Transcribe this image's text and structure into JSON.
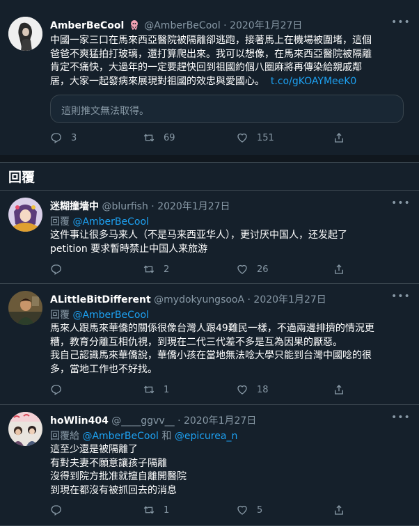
{
  "main_tweet": {
    "name": "AmberBeCool",
    "handle": "@AmberBeCool · 2020年1月27日",
    "lines": [
      "中國一家三口在馬來西亞醫院被隔離卻逃跑，接著馬上在機場被圍堵，這個",
      "爸爸不爽猛拍打玻璃，還打算爬出來。我可以想像，在馬來西亞醫院被隔離",
      "肯定不痛快，大過年的一定要趕快回到祖國約個八圈麻將再傳染給親戚鄰",
      "居，大家一起發病來展現對祖國的效忠與愛國心。"
    ],
    "link": "t.co/gKOAYMeeK0",
    "quote_text": "這則推文無法取得。",
    "replies": "3",
    "retweets": "69",
    "likes": "151"
  },
  "section_title": "回覆",
  "replies": [
    {
      "name": "迷糊撞墻中",
      "handle": "@blurfish · 2020年1月27日",
      "reply_prefix": "回覆",
      "reply_to": "@AmberBeCool",
      "lines": [
        "这件事让很多马来人（不是马来西亚华人），更讨厌中国人，还发起了",
        "petition 要求暫時禁止中国人来旅游"
      ],
      "retweets": "2",
      "likes": "26"
    },
    {
      "name": "ALittleBitDifferent",
      "handle": "@mydokyungsooA · 2020年1月27日",
      "reply_prefix": "回覆",
      "reply_to": "@AmberBeCool",
      "lines": [
        "馬來人跟馬來華僑的關係很像台灣人跟49難民一樣，不過兩邊排擠的情況更",
        "糟，教育分離互相仇視，到現在二代三代差不多是互為因果的厭惡。",
        "我自己認識馬來華僑說，華僑小孩在當地無法唸大學只能到台灣中國唸的很",
        "多，當地工作也不好找。"
      ],
      "retweets": "1",
      "likes": "18"
    },
    {
      "name": "hoWlin404",
      "handle": "@____ggvv__ · 2020年1月27日",
      "reply_prefix": "回覆給",
      "reply_to": "@AmberBeCool",
      "reply_and": "和",
      "reply_to2": "@epicurea_n",
      "lines": [
        "這至少還是被隔離了",
        "有對夫妻不願意讓孩子隔離",
        "沒得到院方批准就擅自離開醫院",
        "到現在都沒有被抓回去的消息"
      ],
      "retweets": "1",
      "likes": "5"
    }
  ],
  "colors": {
    "background": "#15202b",
    "divider": "#38444d",
    "secondary_text": "#8899a6",
    "link": "#1da1f2",
    "verified_badge": "#f4a3b4"
  }
}
